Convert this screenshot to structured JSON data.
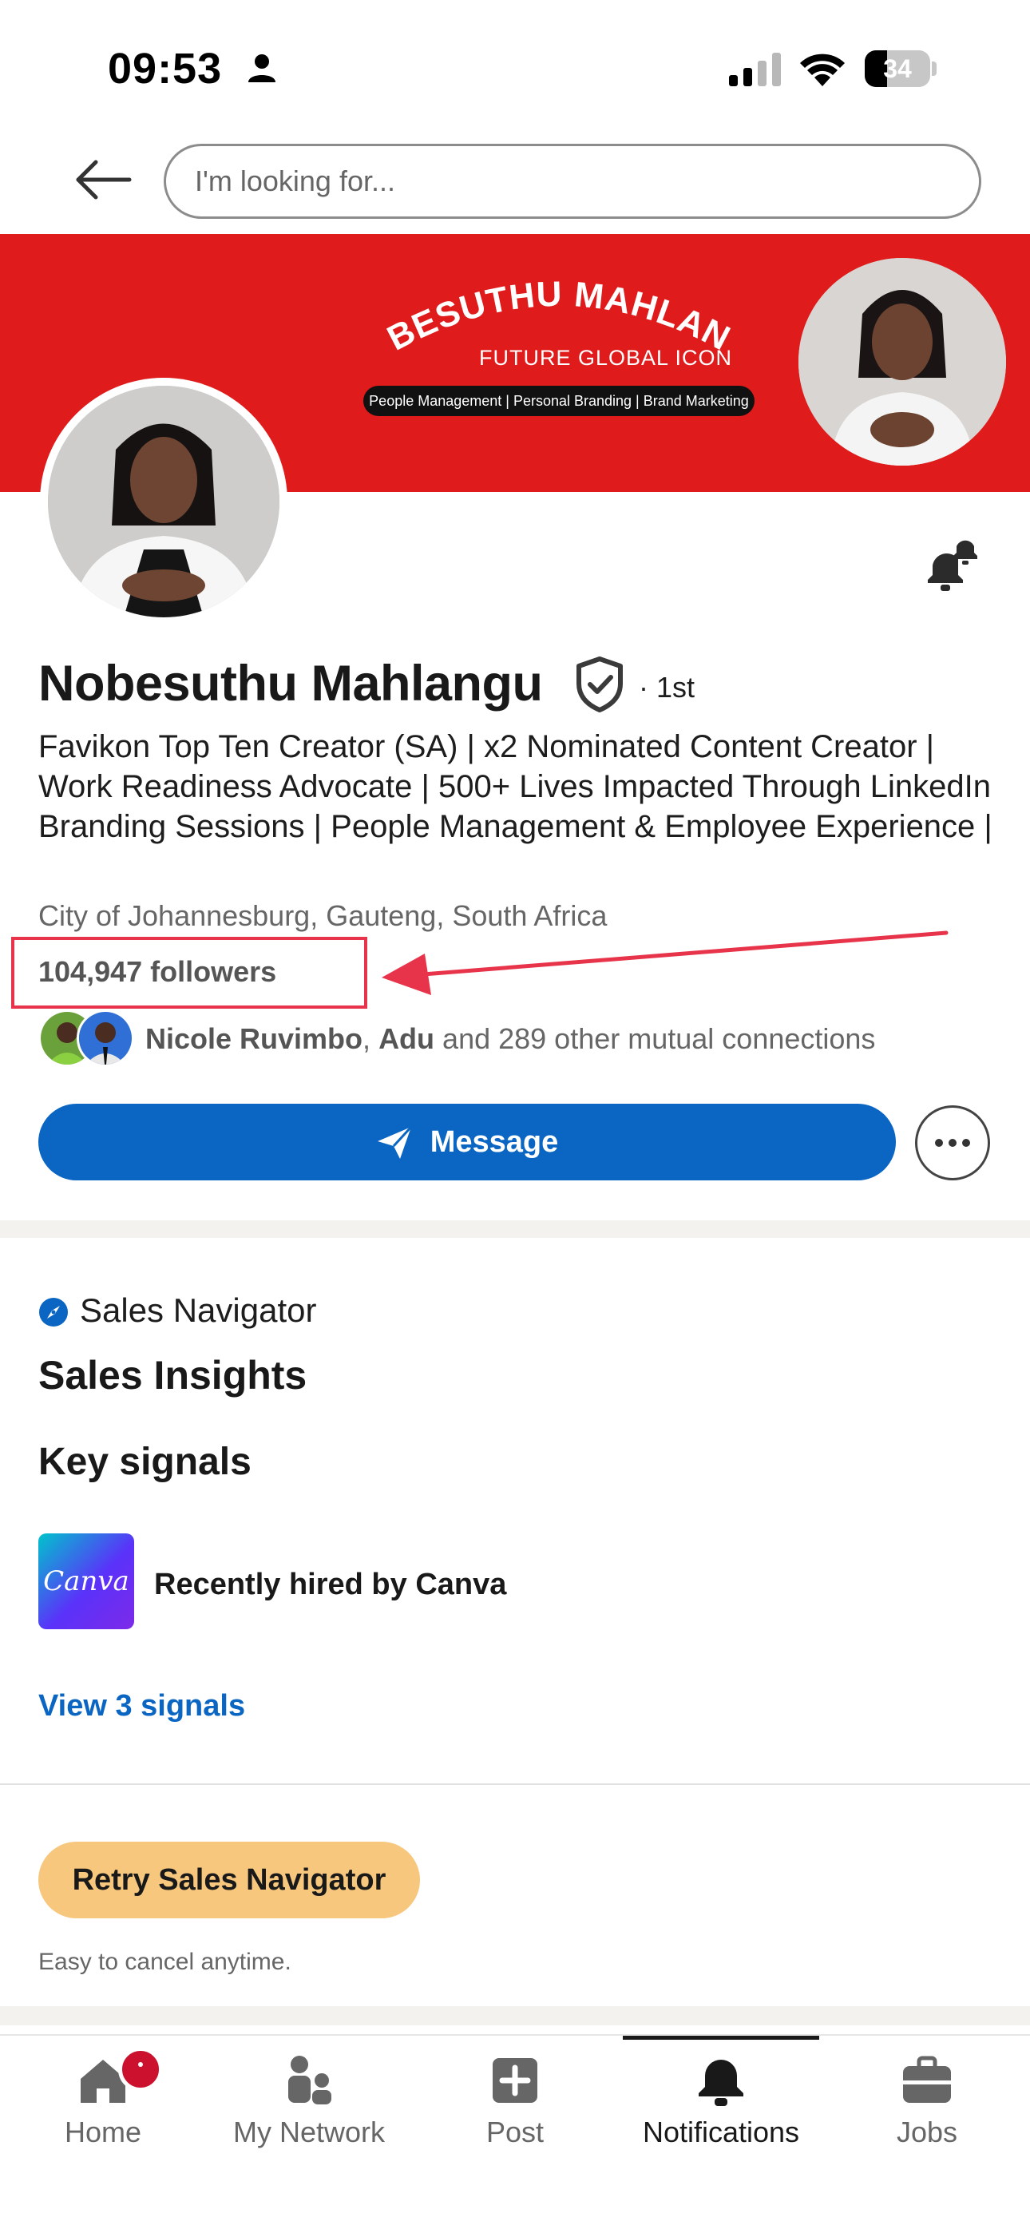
{
  "status_bar": {
    "time": "09:53",
    "battery": "34",
    "battery_level": 0.34
  },
  "search": {
    "placeholder": "I'm looking for..."
  },
  "banner": {
    "name_text": "NOBESUTHU MAHLANGU",
    "subtitle": "FUTURE GLOBAL ICON",
    "tags": "People Management | Personal Branding | Brand Marketing"
  },
  "profile": {
    "name": "Nobesuthu Mahlangu",
    "degree": "· 1st",
    "headline": "Favikon Top Ten Creator (SA) | x2 Nominated Content Creator | Work Readiness Advocate | 500+ Lives Impacted Through LinkedIn Branding Sessions | People Management & Employee Experience |",
    "location": "City of Johannesburg, Gauteng, South Africa",
    "followers": "104,947 followers",
    "mutual": {
      "name1": "Nicole Ruvimbo",
      "separator": ", ",
      "name2": "Adu",
      "rest": " and 289 other mutual connections"
    }
  },
  "actions": {
    "message_label": "Message"
  },
  "sales": {
    "navigator_label": "Sales Navigator",
    "insights_title": "Sales Insights",
    "key_signals_title": "Key signals",
    "canva_logo_text": "Canva",
    "signal_text": "Recently hired by Canva",
    "view_signals": "View 3 signals",
    "retry_label": "Retry Sales Navigator",
    "cancel_note": "Easy to cancel anytime."
  },
  "tabs": [
    {
      "label": "Home",
      "icon": "home-icon"
    },
    {
      "label": "My Network",
      "icon": "network-icon"
    },
    {
      "label": "Post",
      "icon": "post-icon"
    },
    {
      "label": "Notifications",
      "icon": "bell-icon"
    },
    {
      "label": "Jobs",
      "icon": "briefcase-icon"
    }
  ],
  "colors": {
    "brand_blue": "#0a66c2",
    "banner_red": "#e01b1b",
    "annotation_red": "#e8344a",
    "retry_gold": "#f8c77e"
  }
}
